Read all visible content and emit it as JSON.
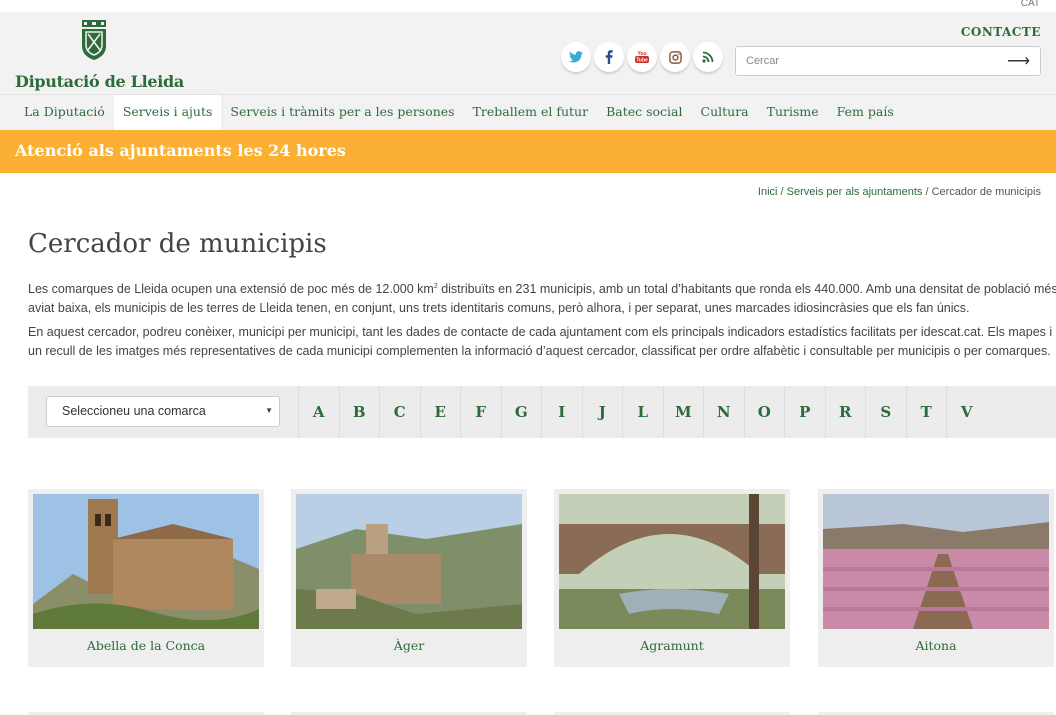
{
  "lang": "CAT",
  "header": {
    "logo_text": "Diputació de Lleida",
    "contact": "CONTACTE",
    "social": [
      "twitter-icon",
      "facebook-icon",
      "youtube-icon",
      "instagram-icon",
      "rss-icon"
    ],
    "search_placeholder": "Cercar",
    "search_arrow": "⟶"
  },
  "nav": {
    "items": [
      "La Diputació",
      "Serveis i ajuts",
      "Serveis i tràmits per a les persones",
      "Treballem el futur",
      "Batec social",
      "Cultura",
      "Turisme",
      "Fem país"
    ],
    "active": "Serveis i ajuts"
  },
  "banner": {
    "text": "Atenció als ajuntaments les 24 hores"
  },
  "breadcrumb": {
    "home": "Inici",
    "sep": " / ",
    "parent": "Serveis per als ajuntaments",
    "current": "Cercador de municipis"
  },
  "page": {
    "title": "Cercador de municipis",
    "p1_a": "Les comarques de Lleida ocupen una extensió de poc més de 12.000 km",
    "p1_sup": "2",
    "p1_b": " distribuïts en 231 municipis, amb un total d’habitants que ronda els 440.000. Amb una densitat de població més aviat baixa, els municipis de les terres de Lleida tenen, en conjunt, uns trets identitaris comuns, però alhora, i per separat, unes marcades idiosincràsies que els fan únics.",
    "p2": "En aquest cercador, podreu conèixer, municipi per municipi, tant les dades de contacte de cada ajuntament com els principals indicadors estadístics facilitats per idescat.cat. Els mapes i un recull de les imatges més representatives de cada municipi complementen la informació d’aquest cercador, classificat per ordre alfabètic i consultable per municipis o per comarques."
  },
  "filter": {
    "select_value": "Seleccioneu una comarca",
    "caret": "▼",
    "letters": [
      "A",
      "B",
      "C",
      "E",
      "F",
      "G",
      "I",
      "J",
      "L",
      "M",
      "N",
      "O",
      "P",
      "R",
      "S",
      "T",
      "V"
    ]
  },
  "municipalities": [
    "Abella de la Conca",
    "Àger",
    "Agramunt",
    "Aitona"
  ],
  "colors": {
    "brand_green": "#2e6b3a",
    "banner_orange": "#fbb034",
    "header_bg": "#f2f2f2"
  }
}
